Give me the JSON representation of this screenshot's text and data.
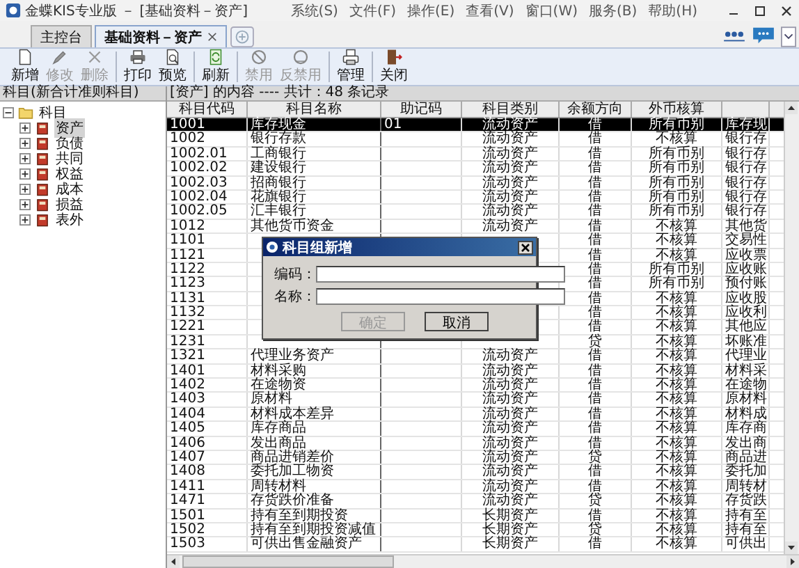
{
  "window": {
    "title": "金蝶KIS专业版 － [基础资料－资产]"
  },
  "menu": [
    "系统(S)",
    "文件(F)",
    "操作(E)",
    "查看(V)",
    "窗口(W)",
    "服务(B)",
    "帮助(H)"
  ],
  "tabs": [
    {
      "label": "主控台",
      "selected": false,
      "closable": false
    },
    {
      "label": "基础资料－资产",
      "selected": true,
      "closable": true
    }
  ],
  "toolbar": {
    "groups": [
      [
        {
          "label": "新增",
          "kind": "new",
          "disabled": false
        },
        {
          "label": "修改",
          "kind": "edit",
          "disabled": true
        },
        {
          "label": "删除",
          "kind": "delete",
          "disabled": true
        }
      ],
      [
        {
          "label": "打印",
          "kind": "print",
          "disabled": false
        },
        {
          "label": "预览",
          "kind": "preview",
          "disabled": false
        }
      ],
      [
        {
          "label": "刷新",
          "kind": "refresh",
          "disabled": false
        }
      ],
      [
        {
          "label": "禁用",
          "kind": "forbid",
          "disabled": true
        },
        {
          "label": "反禁用",
          "kind": "unforbid",
          "disabled": true
        }
      ],
      [
        {
          "label": "管理",
          "kind": "manage",
          "disabled": false
        }
      ],
      [
        {
          "label": "关闭",
          "kind": "close",
          "disabled": false
        }
      ]
    ]
  },
  "tree": {
    "title": "科目(新合计准则科目)",
    "root": {
      "label": "科目",
      "expanded": true,
      "selected": false,
      "children": [
        {
          "label": "资产",
          "expanded": false,
          "selected": true
        },
        {
          "label": "负债",
          "expanded": false,
          "selected": false
        },
        {
          "label": "共同",
          "expanded": false,
          "selected": false
        },
        {
          "label": "权益",
          "expanded": false,
          "selected": false
        },
        {
          "label": "成本",
          "expanded": false,
          "selected": false
        },
        {
          "label": "损益",
          "expanded": false,
          "selected": false
        },
        {
          "label": "表外",
          "expanded": false,
          "selected": false
        }
      ]
    }
  },
  "table": {
    "title": "[资产] 的内容 ---- 共计：48 条记录",
    "columns": [
      "科目代码",
      "科目名称",
      "助记码",
      "科目类别",
      "余额方向",
      "外币核算"
    ],
    "rows": [
      {
        "code": "1001",
        "name": "库存现金",
        "mnemonic": "01",
        "category": "流动资产",
        "direction": "借",
        "currency": "所有币别",
        "column_7": "库存现",
        "selected": true
      },
      {
        "code": "1002",
        "name": "银行存款",
        "category": "流动资产",
        "direction": "借",
        "currency": "不核算",
        "column_7": "银行存",
        "selected": false
      },
      {
        "code": "1002.01",
        "name": "工商银行",
        "category": "流动资产",
        "direction": "借",
        "currency": "所有币别",
        "column_7": "银行存",
        "selected": false
      },
      {
        "code": "1002.02",
        "name": "建设银行",
        "category": "流动资产",
        "direction": "借",
        "currency": "所有币别",
        "column_7": "银行存",
        "selected": false
      },
      {
        "code": "1002.03",
        "name": "招商银行",
        "category": "流动资产",
        "direction": "借",
        "currency": "所有币别",
        "column_7": "银行存",
        "selected": false
      },
      {
        "code": "1002.04",
        "name": "花旗银行",
        "category": "流动资产",
        "direction": "借",
        "currency": "所有币别",
        "column_7": "银行存",
        "selected": false
      },
      {
        "code": "1002.05",
        "name": "汇丰银行",
        "category": "流动资产",
        "direction": "借",
        "currency": "所有币别",
        "column_7": "银行存",
        "selected": false
      },
      {
        "code": "1012",
        "name": "其他货币资金",
        "category": "流动资产",
        "direction": "借",
        "currency": "不核算",
        "column_7": "其他货",
        "selected": false
      },
      {
        "code": "1101",
        "direction": "借",
        "currency": "不核算",
        "column_7": "交易性",
        "selected": false
      },
      {
        "code": "1121",
        "direction": "借",
        "currency": "不核算",
        "column_7": "应收票",
        "selected": false
      },
      {
        "code": "1122",
        "direction": "借",
        "currency": "所有币别",
        "column_7": "应收账",
        "selected": false
      },
      {
        "code": "1123",
        "direction": "借",
        "currency": "所有币别",
        "column_7": "预付账",
        "selected": false
      },
      {
        "code": "1131",
        "direction": "借",
        "currency": "不核算",
        "column_7": "应收股",
        "selected": false
      },
      {
        "code": "1132",
        "direction": "借",
        "currency": "不核算",
        "column_7": "应收利",
        "selected": false
      },
      {
        "code": "1221",
        "direction": "借",
        "currency": "不核算",
        "column_7": "其他应",
        "selected": false
      },
      {
        "code": "1231",
        "direction": "贷",
        "currency": "不核算",
        "column_7": "坏账准",
        "selected": false
      },
      {
        "code": "1321",
        "name": "代理业务资产",
        "category": "流动资产",
        "direction": "借",
        "currency": "不核算",
        "column_7": "代理业",
        "selected": false
      },
      {
        "code": "1401",
        "name": "材料采购",
        "category": "流动资产",
        "direction": "借",
        "currency": "不核算",
        "column_7": "材料采",
        "selected": false
      },
      {
        "code": "1402",
        "name": "在途物资",
        "category": "流动资产",
        "direction": "借",
        "currency": "不核算",
        "column_7": "在途物",
        "selected": false
      },
      {
        "code": "1403",
        "name": "原材料",
        "category": "流动资产",
        "direction": "借",
        "currency": "不核算",
        "column_7": "原材料",
        "selected": false
      },
      {
        "code": "1404",
        "name": "材料成本差异",
        "category": "流动资产",
        "direction": "借",
        "currency": "不核算",
        "column_7": "材料成",
        "selected": false
      },
      {
        "code": "1405",
        "name": "库存商品",
        "category": "流动资产",
        "direction": "借",
        "currency": "不核算",
        "column_7": "库存商",
        "selected": false
      },
      {
        "code": "1406",
        "name": "发出商品",
        "category": "流动资产",
        "direction": "借",
        "currency": "不核算",
        "column_7": "发出商",
        "selected": false
      },
      {
        "code": "1407",
        "name": "商品进销差价",
        "category": "流动资产",
        "direction": "贷",
        "currency": "不核算",
        "column_7": "商品进",
        "selected": false
      },
      {
        "code": "1408",
        "name": "委托加工物资",
        "category": "流动资产",
        "direction": "借",
        "currency": "不核算",
        "column_7": "委托加",
        "selected": false
      },
      {
        "code": "1411",
        "name": "周转材料",
        "category": "流动资产",
        "direction": "借",
        "currency": "不核算",
        "column_7": "周转材",
        "selected": false
      },
      {
        "code": "1471",
        "name": "存货跌价准备",
        "category": "流动资产",
        "direction": "贷",
        "currency": "不核算",
        "column_7": "存货跌",
        "selected": false
      },
      {
        "code": "1501",
        "name": "持有至到期投资",
        "category": "长期资产",
        "direction": "借",
        "currency": "不核算",
        "column_7": "持有至",
        "selected": false
      },
      {
        "code": "1502",
        "name": "持有至到期投资减值",
        "category": "长期资产",
        "direction": "贷",
        "currency": "不核算",
        "column_7": "持有至",
        "selected": false
      },
      {
        "code": "1503",
        "name": "可供出售金融资产",
        "category": "长期资产",
        "direction": "借",
        "currency": "不核算",
        "column_7": "可供出",
        "selected": false
      }
    ]
  },
  "dialog": {
    "title": "科目组新增",
    "fields": [
      {
        "label": "编码："
      },
      {
        "label": "名称："
      }
    ],
    "buttons": [
      {
        "label": "确定",
        "disabled": true
      },
      {
        "label": "取消",
        "disabled": false
      }
    ]
  }
}
